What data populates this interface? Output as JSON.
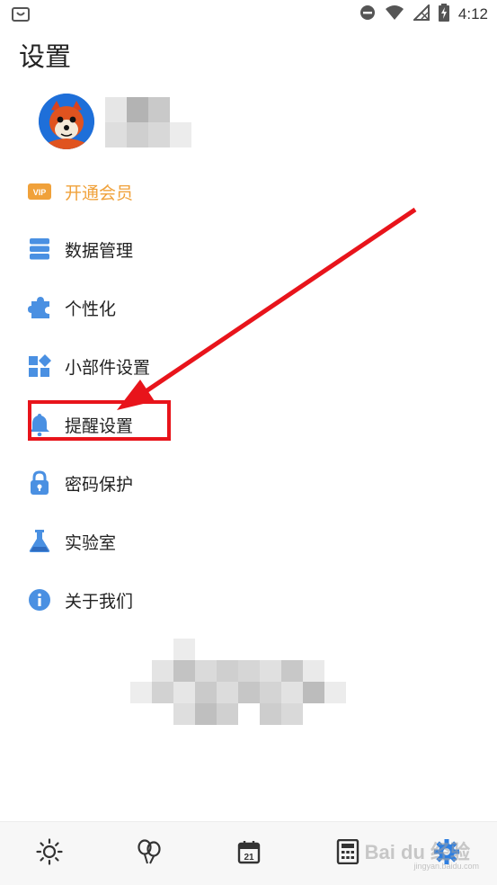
{
  "status_bar": {
    "time": "4:12",
    "icons": [
      "shopping-bag-icon",
      "do-not-disturb-icon",
      "wifi-icon",
      "no-signal-icon",
      "battery-charging-icon"
    ]
  },
  "page": {
    "title": "设置"
  },
  "profile": {
    "avatar": "squirrel-avatar",
    "username": "(pixelated)"
  },
  "menu": {
    "items": [
      {
        "label": "开通会员",
        "icon": "vip-badge-icon",
        "color": "#f0a13a"
      },
      {
        "label": "数据管理",
        "icon": "database-icon"
      },
      {
        "label": "个性化",
        "icon": "puzzle-icon"
      },
      {
        "label": "小部件设置",
        "icon": "widgets-icon"
      },
      {
        "label": "提醒设置",
        "icon": "bell-icon"
      },
      {
        "label": "密码保护",
        "icon": "lock-icon"
      },
      {
        "label": "实验室",
        "icon": "flask-icon"
      },
      {
        "label": "关于我们",
        "icon": "info-icon"
      }
    ]
  },
  "annotation": {
    "highlight_color": "#e8141b",
    "target": "提醒设置"
  },
  "bottom_nav": {
    "items": [
      {
        "icon": "sun-icon"
      },
      {
        "icon": "balloons-icon"
      },
      {
        "icon": "calendar-icon",
        "badge": "21"
      },
      {
        "icon": "calculator-icon"
      },
      {
        "icon": "settings-gear-icon",
        "active": true
      }
    ],
    "watermark": "Bai du 经验",
    "watermark_sub": "jingyan.baidu.com"
  },
  "colors": {
    "accent": "#2f7fe0",
    "icon_blue": "#4a90e2",
    "vip": "#f0a13a",
    "annotation_red": "#e8141b"
  }
}
